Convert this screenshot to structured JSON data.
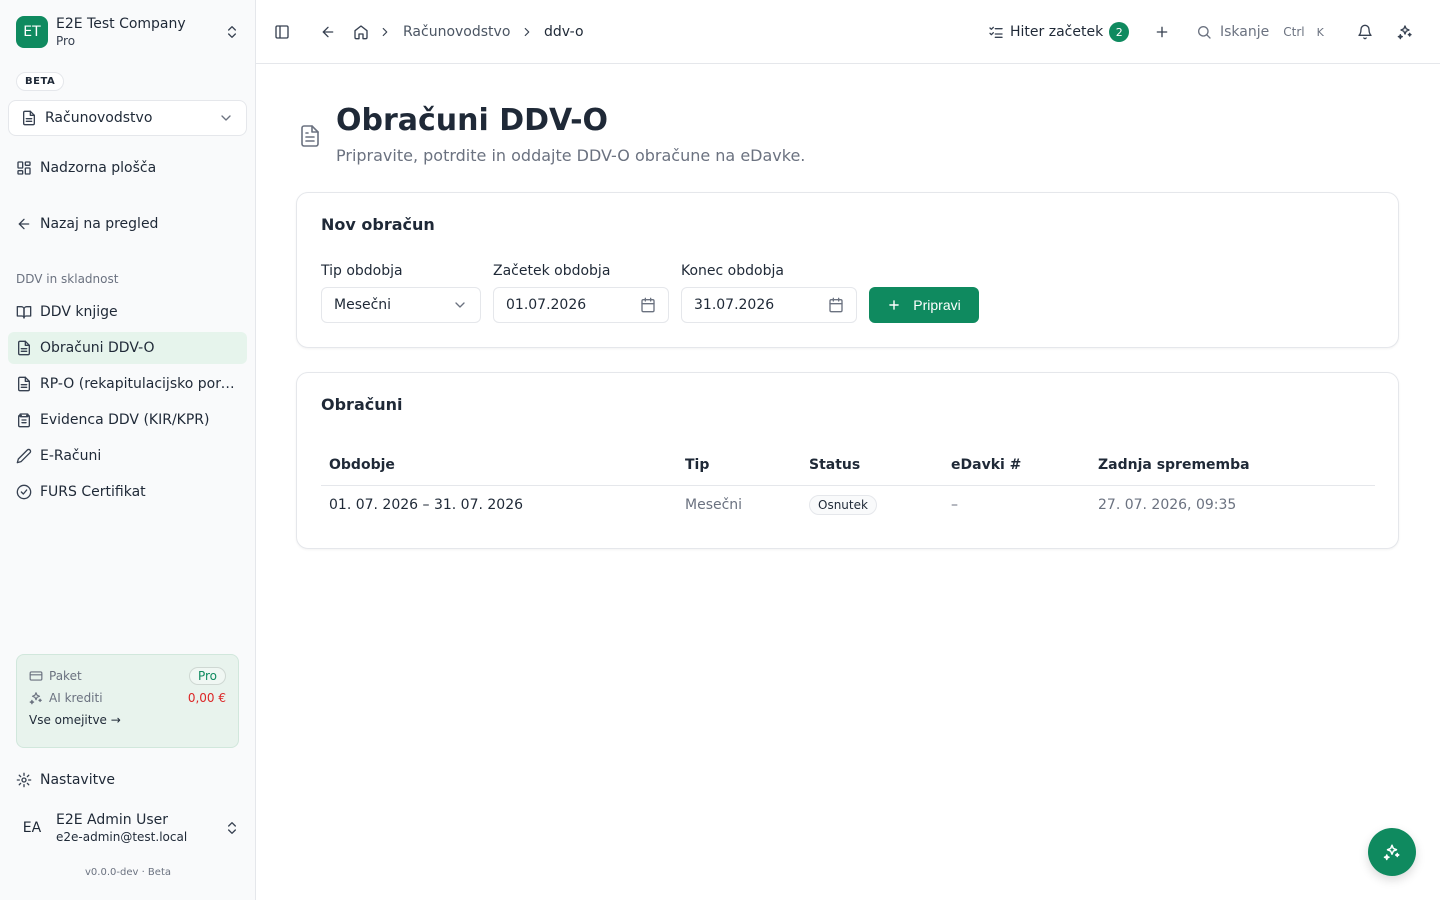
{
  "company": {
    "initials": "ET",
    "name": "E2E Test Company",
    "plan": "Pro"
  },
  "beta_label": "BETA",
  "module": {
    "label": "Računovodstvo"
  },
  "nav": {
    "dashboard": "Nadzorna plošča",
    "back": "Nazaj na pregled",
    "section": "DDV in skladnost",
    "items": [
      {
        "label": "DDV knjige",
        "icon": "book-icon"
      },
      {
        "label": "Obračuni DDV-O",
        "icon": "file-icon"
      },
      {
        "label": "RP-O (rekapitulacijsko poročilo)",
        "icon": "file-icon"
      },
      {
        "label": "Evidenca DDV (KIR/KPR)",
        "icon": "clipboard-icon"
      },
      {
        "label": "E-Računi",
        "icon": "pen-icon"
      },
      {
        "label": "FURS Certifikat",
        "icon": "check-circle-icon"
      }
    ],
    "settings": "Nastavitve"
  },
  "plan_card": {
    "package_label": "Paket",
    "package_value": "Pro",
    "credits_label": "AI krediti",
    "credits_value": "0,00 €",
    "limits_link": "Vse omejitve →"
  },
  "user": {
    "initials": "EA",
    "name": "E2E Admin User",
    "email": "e2e-admin@test.local"
  },
  "version": "v0.0.0-dev · Beta",
  "topbar": {
    "breadcrumb": [
      "Računovodstvo",
      "ddv-o"
    ],
    "quick_start": "Hiter začetek",
    "quick_start_count": "2",
    "search": "Iskanje",
    "kbd_ctrl": "Ctrl",
    "kbd_key": "K"
  },
  "page": {
    "title": "Obračuni DDV-O",
    "subtitle": "Pripravite, potrdite in oddajte DDV-O obračune na eDavke."
  },
  "new_form": {
    "title": "Nov obračun",
    "type_label": "Tip obdobja",
    "type_value": "Mesečni",
    "start_label": "Začetek obdobja",
    "start_value": "01.07.2026",
    "end_label": "Konec obdobja",
    "end_value": "31.07.2026",
    "submit": "Pripravi"
  },
  "list": {
    "title": "Obračuni",
    "columns": [
      "Obdobje",
      "Tip",
      "Status",
      "eDavki #",
      "Zadnja sprememba"
    ],
    "rows": [
      {
        "period": "01. 07. 2026 – 31. 07. 2026",
        "type": "Mesečni",
        "status": "Osnutek",
        "edavki": "–",
        "modified": "27. 07. 2026, 09:35"
      }
    ]
  },
  "colors": {
    "accent": "#0f8a5f",
    "active_bg": "#e6f4ec",
    "danger": "#dc2626"
  }
}
